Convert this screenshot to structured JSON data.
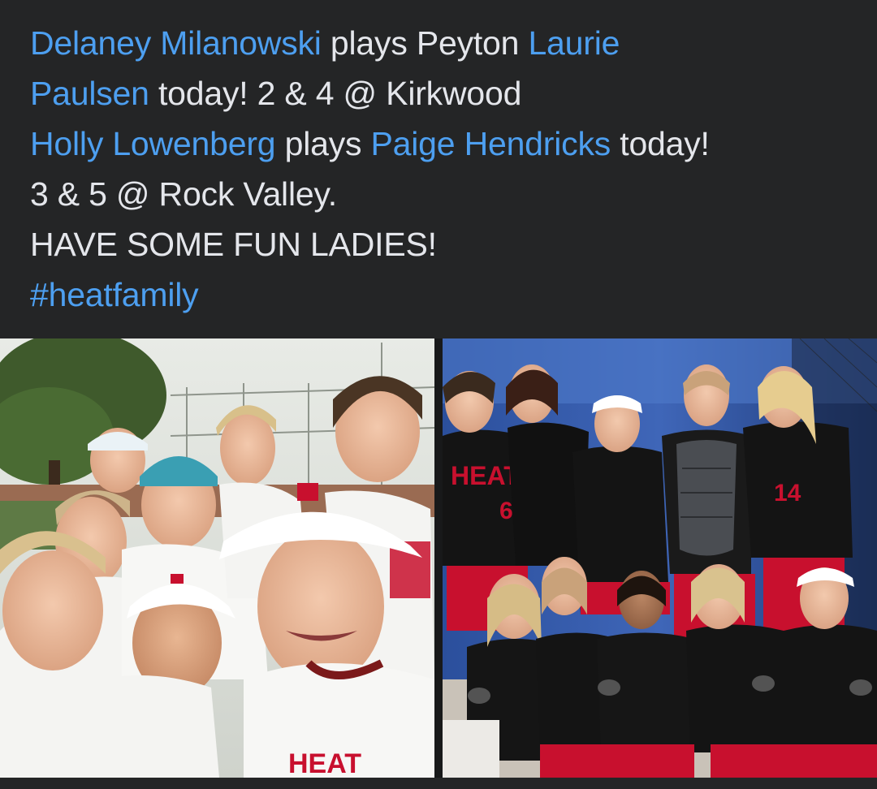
{
  "post": {
    "line1": {
      "mention1": "Delaney Milanowski",
      "text1": " plays Peyton ",
      "mention2": "Laurie"
    },
    "line2": {
      "mention1": "Paulsen",
      "text1": " today! 2 & 4 @ Kirkwood"
    },
    "line3": {
      "mention1": "Holly Lowenberg",
      "text1": " plays ",
      "mention2": "Paige Hendricks",
      "text2": " today!"
    },
    "line4": "3 & 5 @ Rock Valley.",
    "line5": "HAVE SOME FUN LADIES!",
    "line6": "#heatfamily"
  },
  "photos": {
    "left": {
      "jersey_text": "HEAT"
    },
    "right": {
      "jersey_text_a": "HEAT",
      "jersey_number_a": "6",
      "jersey_number_b": "14"
    }
  },
  "colors": {
    "background": "#242526",
    "text": "#e4e6eb",
    "link": "#4d9ff0",
    "team_red": "#c8102e",
    "team_black": "#141414"
  }
}
